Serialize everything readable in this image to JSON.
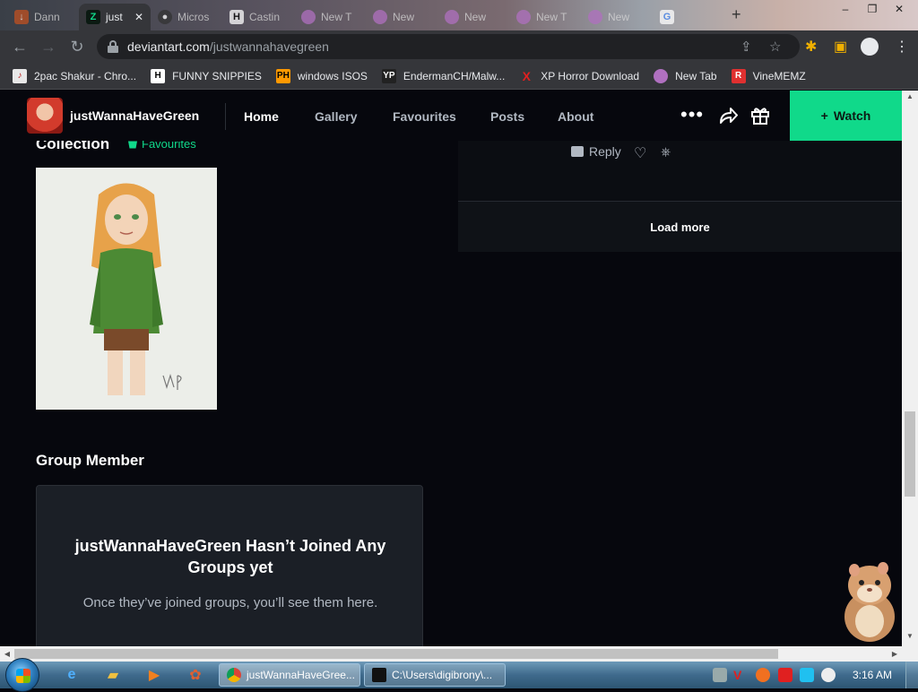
{
  "browser": {
    "tabs": [
      {
        "label": "Dann",
        "active": false
      },
      {
        "label": "just",
        "active": true
      },
      {
        "label": "Micros",
        "active": false
      },
      {
        "label": "Castin",
        "active": false
      },
      {
        "label": "New T",
        "active": false
      },
      {
        "label": "New",
        "active": false
      },
      {
        "label": "New",
        "active": false
      },
      {
        "label": "New T",
        "active": false
      },
      {
        "label": "New",
        "active": false
      },
      {
        "label": "",
        "active": false
      }
    ],
    "url_host": "deviantart.com",
    "url_path": "/justwannahavegreen",
    "bookmarks": [
      {
        "label": "2pac Shakur - Chro...",
        "icon": "music-icon",
        "color": "#e8e8e8"
      },
      {
        "label": "FUNNY SNIPPIES",
        "icon": "H",
        "color": "#ffffff"
      },
      {
        "label": "windows ISOS",
        "icon": "PH",
        "color": "#ff9900"
      },
      {
        "label": "EndermanCH/Malw...",
        "icon": "YP",
        "color": "#222222"
      },
      {
        "label": "XP Horror Download",
        "icon": "X",
        "color": "#e02020"
      },
      {
        "label": "New Tab",
        "icon": "tab-icon",
        "color": "#b070c0"
      },
      {
        "label": "VineMEMZ",
        "icon": "R",
        "color": "#e03030"
      }
    ]
  },
  "site": {
    "username": "justWannaHaveGreen",
    "nav": [
      {
        "label": "Home",
        "active": true
      },
      {
        "label": "Gallery",
        "active": false
      },
      {
        "label": "Favourites",
        "active": false
      },
      {
        "label": "Posts",
        "active": false
      },
      {
        "label": "About",
        "active": false
      }
    ],
    "more": "•••",
    "watch_label": "Watch",
    "watch_prefix": "+",
    "accent": "#10d98a"
  },
  "collection": {
    "title": "Collection",
    "favourites_link": "Favourites"
  },
  "group": {
    "title": "Group Member",
    "empty_title": "justWannaHaveGreen Hasn’t Joined Any Groups yet",
    "empty_subtitle": "Once they’ve joined groups, you’ll see them here."
  },
  "comments": {
    "reply_label": "Reply",
    "load_more_label": "Load more"
  },
  "taskbar": {
    "tasks": [
      {
        "label": "justWannaHaveGree...",
        "active": true
      },
      {
        "label": "C:\\Users\\digibrony\\...",
        "active": false
      }
    ],
    "clock": "3:16 AM"
  }
}
